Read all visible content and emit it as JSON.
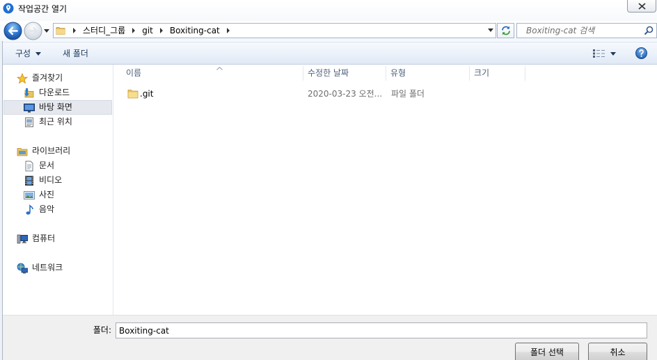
{
  "window": {
    "title": "작업공간 열기",
    "title_icon": "location-pin-icon"
  },
  "address_bar": {
    "breadcrumb": [
      "스터디_그룹",
      "git",
      "Boxiting-cat"
    ],
    "search_placeholder": "Boxiting-cat 검색"
  },
  "toolbar": {
    "organize_label": "구성",
    "new_folder_label": "새 폴더"
  },
  "nav": {
    "groups": [
      {
        "label": "즐겨찾기",
        "icon": "star-icon",
        "items": [
          {
            "label": "다운로드",
            "icon": "downloads-folder-icon"
          },
          {
            "label": "바탕 화면",
            "icon": "desktop-icon",
            "selected": true
          },
          {
            "label": "최근 위치",
            "icon": "recent-places-icon"
          }
        ]
      },
      {
        "label": "라이브러리",
        "icon": "library-icon",
        "items": [
          {
            "label": "문서",
            "icon": "documents-icon"
          },
          {
            "label": "비디오",
            "icon": "videos-icon"
          },
          {
            "label": "사진",
            "icon": "pictures-icon"
          },
          {
            "label": "음악",
            "icon": "music-icon"
          }
        ]
      },
      {
        "label": "컴퓨터",
        "icon": "computer-icon",
        "items": []
      },
      {
        "label": "네트워크",
        "icon": "network-icon",
        "items": []
      }
    ]
  },
  "file_list": {
    "columns": [
      "이름",
      "수정한 날짜",
      "유형",
      "크기"
    ],
    "rows": [
      {
        "name": ".git",
        "modified": "2020-03-23 오전...",
        "type": "파일 폴더",
        "icon": "folder-icon"
      }
    ]
  },
  "footer": {
    "folder_label": "폴더:",
    "folder_value": "Boxiting-cat",
    "select_button": "폴더 선택",
    "cancel_button": "취소"
  },
  "theme": {
    "selection_bg": "#e5e9ef",
    "selection_border": "#d3d9e2",
    "accent": "#1f6fd1"
  }
}
